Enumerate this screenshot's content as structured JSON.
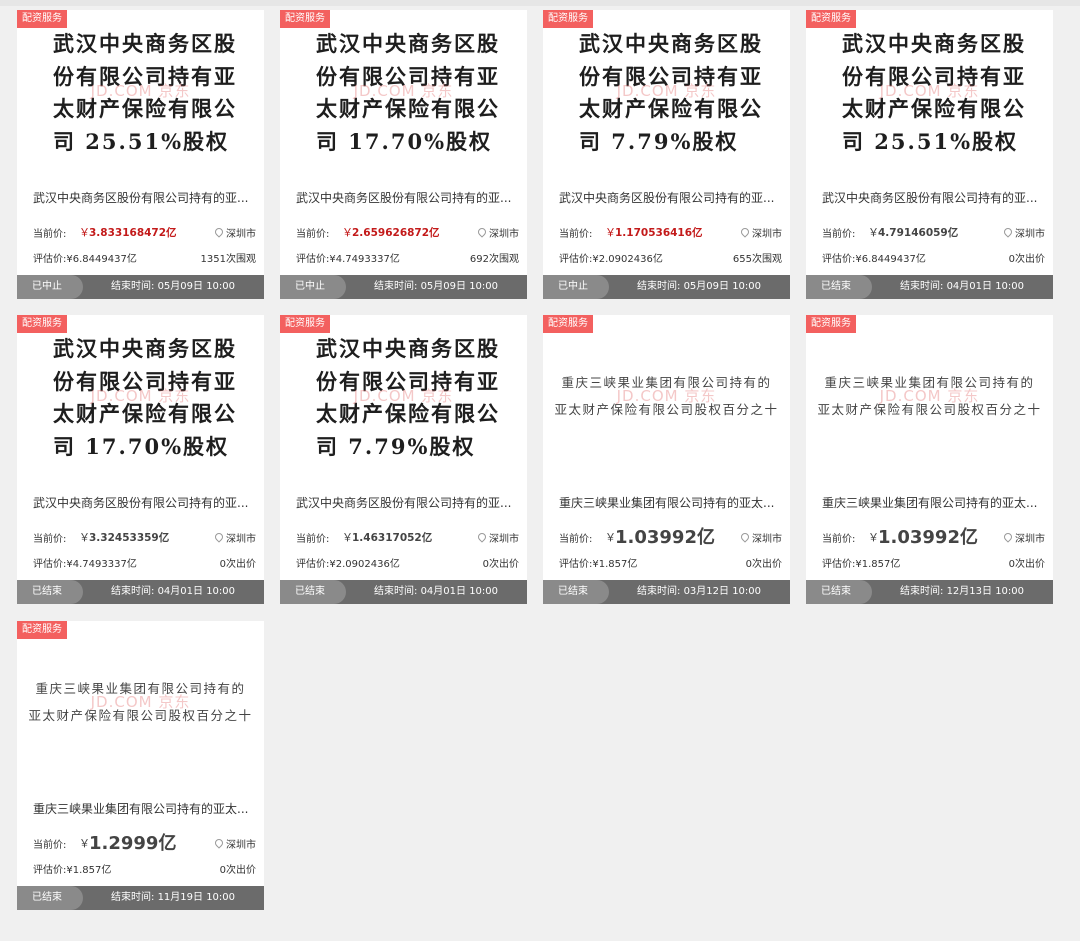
{
  "watermark": "JD.COM 京东",
  "labels": {
    "current_price": "当前价:",
    "currency": "￥",
    "eval_prefix": "评估价:",
    "end_prefix": "结束时间: "
  },
  "cards": [
    {
      "badge": "配资服务",
      "thumb_style": "big",
      "thumb_lines": [
        "武汉中央商务区股",
        "份有限公司持有亚",
        "太财产保险有限公",
        "司 25.51%股权"
      ],
      "title": "武汉中央商务区股份有限公司持有的亚...",
      "price": "3.833168472亿",
      "price_style": "red",
      "location": "深圳市",
      "eval": "¥6.8449437亿",
      "count": "1351次围观",
      "status": "已中止",
      "end_time": "05月09日 10:00"
    },
    {
      "badge": "配资服务",
      "thumb_style": "big",
      "thumb_lines": [
        "武汉中央商务区股",
        "份有限公司持有亚",
        "太财产保险有限公",
        "司 17.70%股权"
      ],
      "title": "武汉中央商务区股份有限公司持有的亚...",
      "price": "2.659626872亿",
      "price_style": "red",
      "location": "深圳市",
      "eval": "¥4.7493337亿",
      "count": "692次围观",
      "status": "已中止",
      "end_time": "05月09日 10:00"
    },
    {
      "badge": "配资服务",
      "thumb_style": "big",
      "thumb_lines": [
        "武汉中央商务区股",
        "份有限公司持有亚",
        "太财产保险有限公",
        "司 7.79%股权"
      ],
      "title": "武汉中央商务区股份有限公司持有的亚...",
      "price": "1.170536416亿",
      "price_style": "red",
      "location": "深圳市",
      "eval": "¥2.0902436亿",
      "count": "655次围观",
      "status": "已中止",
      "end_time": "05月09日 10:00"
    },
    {
      "badge": "配资服务",
      "thumb_style": "big",
      "thumb_lines": [
        "武汉中央商务区股",
        "份有限公司持有亚",
        "太财产保险有限公",
        "司 25.51%股权"
      ],
      "title": "武汉中央商务区股份有限公司持有的亚...",
      "price": "4.79146059亿",
      "price_style": "gray",
      "location": "深圳市",
      "eval": "¥6.8449437亿",
      "count": "0次出价",
      "status": "已结束",
      "end_time": "04月01日 10:00"
    },
    {
      "badge": "配资服务",
      "thumb_style": "big",
      "thumb_lines": [
        "武汉中央商务区股",
        "份有限公司持有亚",
        "太财产保险有限公",
        "司 17.70%股权"
      ],
      "title": "武汉中央商务区股份有限公司持有的亚...",
      "price": "3.32453359亿",
      "price_style": "gray",
      "location": "深圳市",
      "eval": "¥4.7493337亿",
      "count": "0次出价",
      "status": "已结束",
      "end_time": "04月01日 10:00"
    },
    {
      "badge": "配资服务",
      "thumb_style": "big",
      "thumb_lines": [
        "武汉中央商务区股",
        "份有限公司持有亚",
        "太财产保险有限公",
        "司 7.79%股权"
      ],
      "title": "武汉中央商务区股份有限公司持有的亚...",
      "price": "1.46317052亿",
      "price_style": "gray",
      "location": "深圳市",
      "eval": "¥2.0902436亿",
      "count": "0次出价",
      "status": "已结束",
      "end_time": "04月01日 10:00"
    },
    {
      "badge": "配资服务",
      "thumb_style": "small",
      "thumb_lines": [
        "重庆三峡果业集团有限公司持有的",
        "亚太财产保险有限公司股权百分之十"
      ],
      "title": "重庆三峡果业集团有限公司持有的亚太...",
      "price": "1.03992亿",
      "price_style": "big",
      "location": "深圳市",
      "eval": "¥1.857亿",
      "count": "0次出价",
      "status": "已结束",
      "end_time": "03月12日 10:00"
    },
    {
      "badge": "配资服务",
      "thumb_style": "small",
      "thumb_lines": [
        "重庆三峡果业集团有限公司持有的",
        "亚太财产保险有限公司股权百分之十"
      ],
      "title": "重庆三峡果业集团有限公司持有的亚太...",
      "price": "1.03992亿",
      "price_style": "big",
      "location": "深圳市",
      "eval": "¥1.857亿",
      "count": "0次出价",
      "status": "已结束",
      "end_time": "12月13日 10:00"
    },
    {
      "badge": "配资服务",
      "thumb_style": "small",
      "thumb_lines": [
        "重庆三峡果业集团有限公司持有的",
        "亚太财产保险有限公司股权百分之十"
      ],
      "title": "重庆三峡果业集团有限公司持有的亚太...",
      "price": "1.2999亿",
      "price_style": "big",
      "location": "深圳市",
      "eval": "¥1.857亿",
      "count": "0次出价",
      "status": "已结束",
      "end_time": "11月19日 10:00"
    }
  ]
}
